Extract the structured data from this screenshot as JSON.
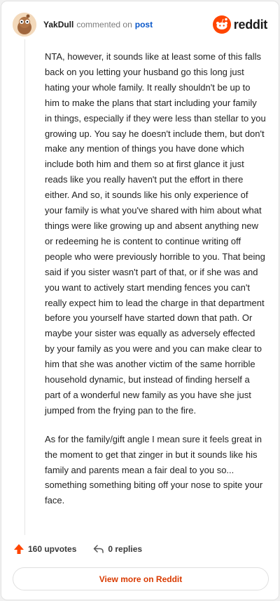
{
  "header": {
    "username": "YakDull",
    "action": "commented on",
    "post_link": "post",
    "brand": "reddit"
  },
  "comment": {
    "paragraphs": [
      "NTA, however, it sounds like at least some of this falls back on you letting your husband go this long just hating your whole family. It really shouldn't be up to him to make the plans that start including your family in things, especially if they were less than stellar to you growing up. You say he doesn't include them, but don't make any mention of things you have done which include both him and them so at first glance it just reads like you really haven't put the effort in there either. And so, it sounds like his only experience of your family is what you've shared with him about what things were like growing up and absent anything new or redeeming he is content to continue writing off people who were previously horrible to you. That being said if you sister wasn't part of that, or if she was and you want to actively start mending fences you can't really expect him to lead the charge in that department before you yourself have started down that path. Or maybe your sister was equally as adversely effected by your family as you were and you can make clear to him that she was another victim of the same horrible household dynamic, but instead of finding herself a part of a wonderful new family as you have she just jumped from the frying pan to the fire.",
      "As for the family/gift angle I mean sure it feels great in the moment to get that zinger in but it sounds like his family and parents mean a fair deal to you so... something something biting off your nose to spite your face."
    ]
  },
  "footer": {
    "upvotes": "160 upvotes",
    "replies": "0 replies",
    "view_more": "View more on Reddit"
  },
  "colors": {
    "upvote": "#ff4500",
    "brand": "#ff4500",
    "link": "#0a58ca",
    "view_more": "#d93a00"
  },
  "icons": {
    "avatar": "snoo-avatar-icon",
    "brand": "reddit-logo-icon",
    "upvote": "upvote-arrow-icon",
    "reply": "reply-arrow-icon"
  }
}
